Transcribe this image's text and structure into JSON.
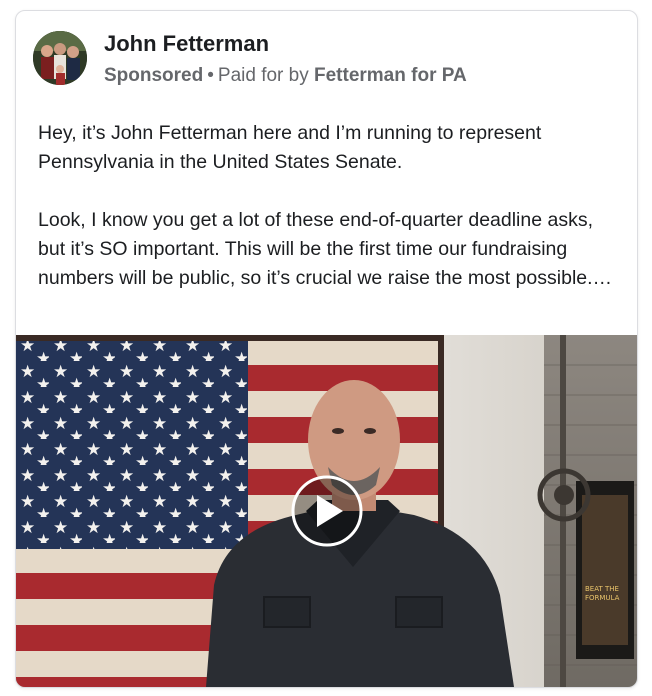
{
  "post": {
    "author": "John Fetterman",
    "sponsored_label": "Sponsored",
    "separator": "•",
    "paid_for_prefix": "Paid for by",
    "paid_for_org": "Fetterman for PA",
    "paragraphs": [
      "Hey, it’s John Fetterman here and I’m running to represent Pennsylvania in the United States Senate.",
      "Look, I know you get a lot of these end-of-quarter deadline asks, but it’s SO important. This will be the first time our fundraising numbers will be public, so it’s crucial we raise the most possible.…"
    ],
    "video": {
      "play_icon": "play-icon",
      "poster_text": "BEAT THE FORMULA"
    }
  }
}
